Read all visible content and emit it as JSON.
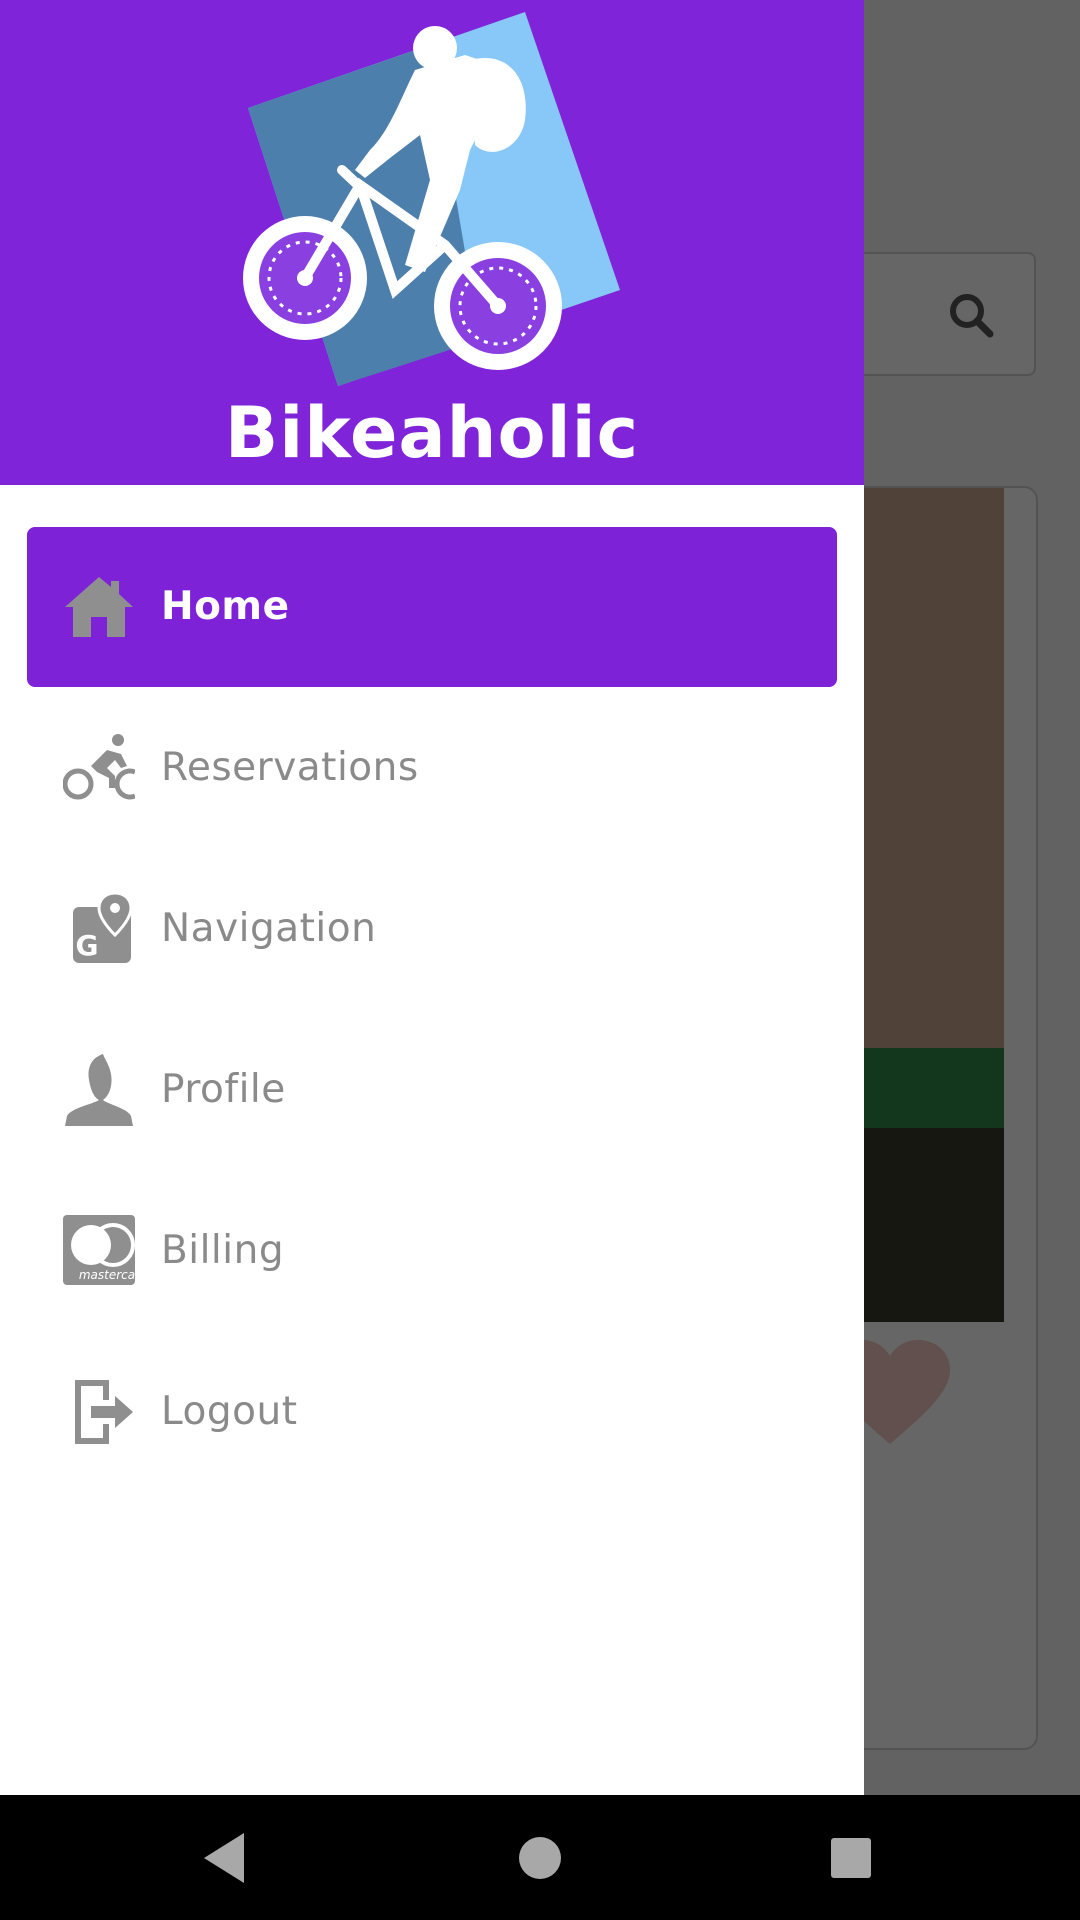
{
  "app": {
    "brand_name": "Bikeaholic",
    "colors": {
      "header_bg": "#8024d9",
      "active_item_bg": "#7e22d8",
      "icon_gray": "#8f8f8f",
      "label_gray": "#8a8a8a"
    }
  },
  "drawer": {
    "items": [
      {
        "label": "Home",
        "icon": "home-icon",
        "active": true
      },
      {
        "label": "Reservations",
        "icon": "cyclist-icon",
        "active": false
      },
      {
        "label": "Navigation",
        "icon": "map-pin-icon",
        "active": false
      },
      {
        "label": "Profile",
        "icon": "person-icon",
        "active": false
      },
      {
        "label": "Billing",
        "icon": "mastercard-icon",
        "active": false
      },
      {
        "label": "Logout",
        "icon": "logout-icon",
        "active": false
      }
    ]
  },
  "background": {
    "search_icon": "search-icon",
    "heart_icon": "heart-icon"
  },
  "navbar": {
    "buttons": [
      "back-triangle-icon",
      "home-circle-icon",
      "recents-square-icon"
    ]
  }
}
